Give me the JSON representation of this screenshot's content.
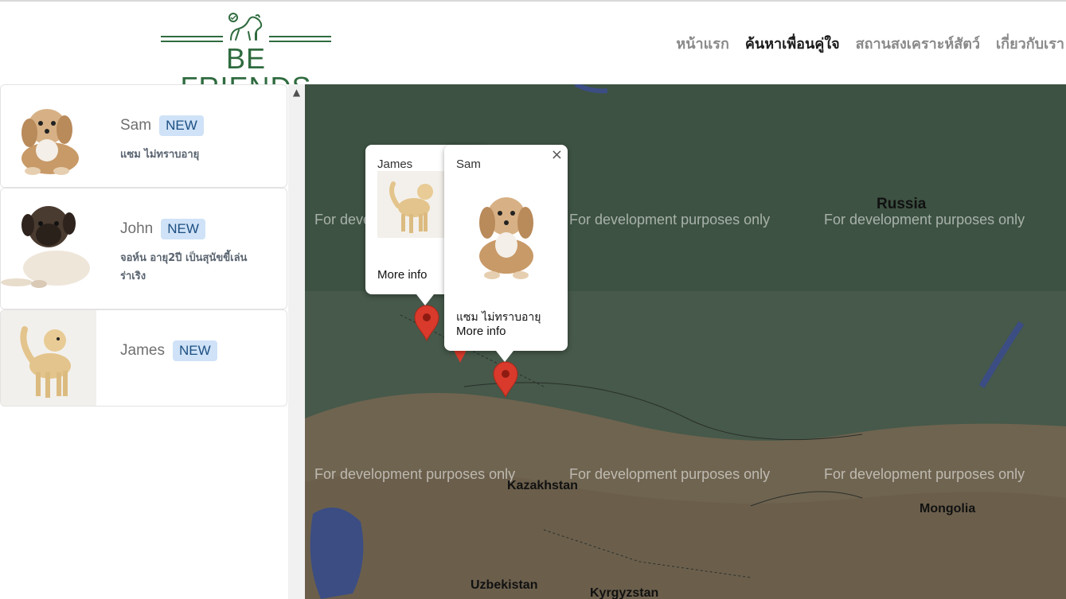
{
  "brand": {
    "name": "BE FRIENDS",
    "color": "#2f6b3f"
  },
  "nav": {
    "items": [
      {
        "label": "หน้าแรก",
        "active": false
      },
      {
        "label": "ค้นหาเพื่อนคู่ใจ",
        "active": true
      },
      {
        "label": "สถานสงเคราะห์สัตว์",
        "active": false
      },
      {
        "label": "เกี่ยวกับเรา",
        "active": false
      }
    ]
  },
  "pets": [
    {
      "name": "Sam",
      "badge": "NEW",
      "desc": "แซม ไม่ทราบอายุ",
      "photo_icon": "dog-photo-icon"
    },
    {
      "name": "John",
      "badge": "NEW",
      "desc": "จอห์น อายุ2ปี เป็นสุนัขขี้เล่น ร่าเริง",
      "photo_icon": "dog-photo-icon"
    },
    {
      "name": "James",
      "badge": "NEW",
      "desc": "",
      "photo_icon": "dog-photo-icon"
    }
  ],
  "map": {
    "watermark": "For development purposes only",
    "places": {
      "russia": "Russia",
      "kazakhstan": "Kazakhstan",
      "mongolia": "Mongolia",
      "uzbekistan": "Uzbekistan",
      "kyrgyzstan": "Kyrgyzstan"
    },
    "marker_color": "#d93a2b",
    "info_windows": {
      "james": {
        "title": "James",
        "link": "More info"
      },
      "sam": {
        "title": "Sam",
        "desc": "แซม ไม่ทราบอายุ",
        "link": "More info",
        "close": "×"
      }
    }
  }
}
